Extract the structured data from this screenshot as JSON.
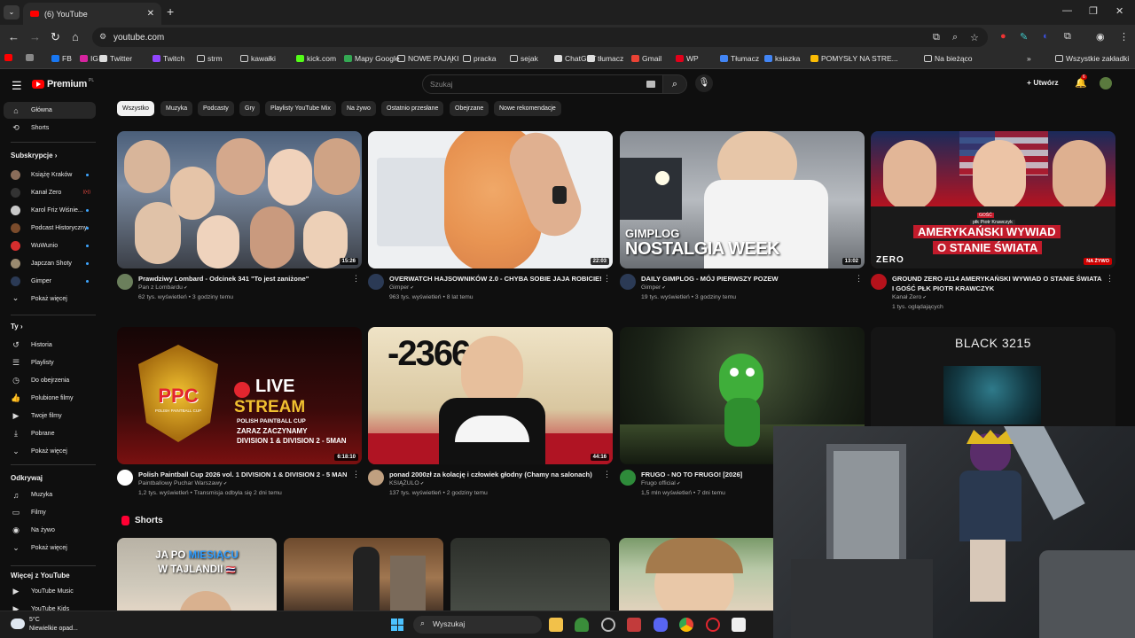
{
  "browser": {
    "tab_title": "(6) YouTube",
    "tab_list_icon": "chevron-down-icon",
    "url": "youtube.com",
    "bookmarks": [
      {
        "label": "",
        "color": "#ff0000"
      },
      {
        "label": "",
        "color": "#888888"
      },
      {
        "label": "FB",
        "color": "#1877f2"
      },
      {
        "label": "IG",
        "color": "#d6249f"
      },
      {
        "label": "Twitter",
        "color": "#dddddd"
      },
      {
        "label": "Twitch",
        "color": "#9146ff"
      },
      {
        "label": "strm",
        "color": "folder"
      },
      {
        "label": "kawałki",
        "color": "folder"
      },
      {
        "label": "kick.com",
        "color": "#53fc18"
      },
      {
        "label": "Mapy Google",
        "color": "#34a853"
      },
      {
        "label": "NOWE PAJĄKI",
        "color": "folder"
      },
      {
        "label": "pracka",
        "color": "folder"
      },
      {
        "label": "sejak",
        "color": "folder"
      },
      {
        "label": "ChatGPT",
        "color": "#dddddd"
      },
      {
        "label": "tłumacz",
        "color": "#dddddd"
      },
      {
        "label": "Gmail",
        "color": "#ea4335"
      },
      {
        "label": "WP",
        "color": "#e2001a"
      },
      {
        "label": "Tłumacz",
        "color": "#4285f4"
      },
      {
        "label": "ksiazka",
        "color": "#4285f4"
      },
      {
        "label": "POMYSŁY NA STRE...",
        "color": "#fbbc04"
      },
      {
        "label": "Na bieżąco",
        "color": "folder"
      }
    ],
    "all_bookmarks": "Wszystkie zakładki"
  },
  "yt": {
    "logo_text": "Premium",
    "logo_sup": "PL",
    "search_placeholder": "Szukaj",
    "create_label": "Utwórz",
    "notif_count": "6"
  },
  "sidebar": {
    "main": [
      {
        "label": "Główna",
        "icon": "home-icon",
        "glyph": "⌂"
      },
      {
        "label": "Shorts",
        "icon": "shorts-icon",
        "glyph": "⟲"
      }
    ],
    "subs_title": "Subskrypcje",
    "subs": [
      {
        "label": "Książę Kraków",
        "color": "#8a6d5a",
        "badge": "dot"
      },
      {
        "label": "Kanał Zero",
        "color": "#333333",
        "badge": "live"
      },
      {
        "label": "Karol Friz Wiśnie...",
        "color": "#c9c9c9",
        "badge": "dot"
      },
      {
        "label": "Podcast Historyczny",
        "color": "#7a4b2b",
        "badge": "dot"
      },
      {
        "label": "WuWunio",
        "color": "#d62e2e",
        "badge": "dot"
      },
      {
        "label": "Japczan Shoty",
        "color": "#9a8a70",
        "badge": "dot"
      },
      {
        "label": "Gimper",
        "color": "#2b3a55",
        "badge": "dot"
      },
      {
        "label": "Pokaż więcej",
        "color": "",
        "badge": ""
      }
    ],
    "you_title": "Ty",
    "you": [
      {
        "label": "Historia",
        "glyph": "↺"
      },
      {
        "label": "Playlisty",
        "glyph": "☰"
      },
      {
        "label": "Do obejrzenia",
        "glyph": "◷"
      },
      {
        "label": "Polubione filmy",
        "glyph": "👍"
      },
      {
        "label": "Twoje filmy",
        "glyph": "▶"
      },
      {
        "label": "Pobrane",
        "glyph": "⤓"
      },
      {
        "label": "Pokaż więcej",
        "glyph": "⌄"
      }
    ],
    "explore_title": "Odkrywaj",
    "explore": [
      {
        "label": "Muzyka",
        "glyph": "♫"
      },
      {
        "label": "Filmy",
        "glyph": "▭"
      },
      {
        "label": "Na żywo",
        "glyph": "◉"
      },
      {
        "label": "Pokaż więcej",
        "glyph": "⌄"
      }
    ],
    "more_title": "Więcej z YouTube",
    "more": [
      {
        "label": "YouTube Music",
        "color": "#ff0000"
      },
      {
        "label": "YouTube Kids",
        "color": "#ff0000"
      }
    ]
  },
  "chips": [
    "Wszystko",
    "Muzyka",
    "Podcasty",
    "Gry",
    "Playlisty YouTube Mix",
    "Na żywo",
    "Ostatnio przesłane",
    "Obejrzane",
    "Nowe rekomendacje"
  ],
  "videos": [
    {
      "title": "Prawdziwy Lombard - Odcinek 341 \"To jest zaniżone\"",
      "channel": "Pan z Lombardu",
      "meta": "62 tys. wyświetleń • 3 godziny temu",
      "duration": "15:26",
      "avatar": "#6b7f5c"
    },
    {
      "title": "OVERWATCH HAJSOWNIKÓW 2.0 - CHYBA SOBIE JAJA ROBICIE!",
      "channel": "Gimper",
      "meta": "963 tys. wyświetleń • 8 lat temu",
      "duration": "22:03",
      "avatar": "#2b3a55"
    },
    {
      "title": "DAILY GIMPLOG - MÓJ PIERWSZY POZEW",
      "channel": "Gimper",
      "meta": "19 tys. wyświetleń • 3 godziny temu",
      "duration": "13:02",
      "avatar": "#2b3a55"
    },
    {
      "title": "GROUND ZERO #114 AMERYKAŃSKI WYWIAD O STANIE ŚWIATA I GOŚĆ PŁK PIOTR KRAWCZYK",
      "channel": "Kanał Zero",
      "meta": "1 tys. oglądających",
      "duration": "NA ŻYWO",
      "avatar": "#b5121b"
    },
    {
      "title": "Polish Paintball Cup 2026 vol. 1 DIVISION 1 & DIVISION 2 - 5 MAN",
      "channel": "Paintballowy Puchar Warszawy",
      "meta": "1,2 tys. wyświetleń • Transmisja odbyła się 2 dni temu",
      "duration": "6:18:10",
      "avatar": "#ffffff"
    },
    {
      "title": "ponad 2000zł za kolację i człowiek głodny (Chamy na salonach)",
      "channel": "KSIĄŻULO",
      "meta": "137 tys. wyświetleń • 2 godziny temu",
      "duration": "44:16",
      "avatar": "#c0a080"
    },
    {
      "title": "FRUGO - NO TO FRUGO! [2026]",
      "channel": "Frugo official",
      "meta": "1,5 mln wyświetleń • 7 dni temu",
      "duration": "",
      "avatar": "#2e8b3a"
    },
    {
      "title": "",
      "channel": "",
      "meta": "",
      "duration": "",
      "avatar": ""
    }
  ],
  "thumb_text": {
    "gimplog_1": "GIMPLOG",
    "gimplog_2": "NOSTALGIA WEEK",
    "gz_guest": "GOŚĆ",
    "gz_guest_name": "płk Piotr Krawczyk",
    "gz_title_1": "AMERYKAŃSKI WYWIAD",
    "gz_title_2": "O STANIE ŚWIATA",
    "gz_logo": "ZERO",
    "ppc_logo": "PPC",
    "ppc_live": "LIVE",
    "ppc_stream": "STREAM",
    "ppc_cup": "POLISH PAINTBALL CUP",
    "ppc_line1": "ZARAZ ZACZYNAMY",
    "ppc_line2": "DIVISION 1 & DIVISION 2 - 5MAN",
    "ppc_badge": "POLISH PAINTBALL CUP",
    "ks_price": "-2366zł",
    "black": "BLACK 3215"
  },
  "shorts": {
    "title": "Shorts",
    "first_caption_1": "JA PO",
    "first_caption_hl": "MIESIĄCU",
    "first_caption_2": "W TAJLANDII"
  },
  "taskbar": {
    "temp": "5°C",
    "weather": "Niewielkie opad...",
    "search": "Wyszukaj"
  }
}
